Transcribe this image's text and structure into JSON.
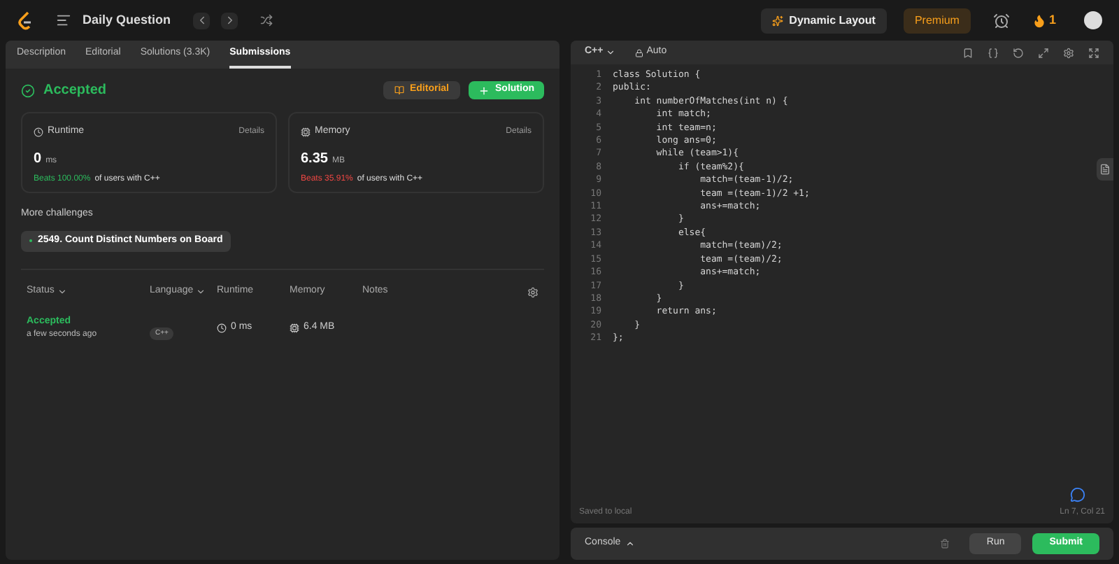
{
  "topbar": {
    "title": "Daily Question",
    "layout_button": "Dynamic Layout",
    "premium": "Premium",
    "streak": "1"
  },
  "tabs": [
    {
      "label": "Description",
      "selected": false
    },
    {
      "label": "Editorial",
      "selected": false
    },
    {
      "label": "Solutions (3.3K)",
      "selected": false
    },
    {
      "label": "Submissions",
      "selected": true
    }
  ],
  "result": {
    "status": "Accepted",
    "editorial_button": "Editorial",
    "solution_button": "Solution",
    "stats": [
      {
        "kind": "runtime",
        "label": "Runtime",
        "details": "Details",
        "value": "0",
        "unit": "ms",
        "beats": "Beats 100.00%",
        "beats_good": true,
        "suffix": "of users with C++"
      },
      {
        "kind": "memory",
        "label": "Memory",
        "details": "Details",
        "value": "6.35",
        "unit": "MB",
        "beats": "Beats 35.91%",
        "beats_good": false,
        "suffix": "of users with C++"
      }
    ]
  },
  "more_challenges": {
    "heading": "More challenges",
    "items": [
      "2549. Count Distinct Numbers on Board"
    ]
  },
  "table": {
    "columns": [
      {
        "label": "Status",
        "sortable": true
      },
      {
        "label": "Language",
        "sortable": true
      },
      {
        "label": "Runtime",
        "sortable": false
      },
      {
        "label": "Memory",
        "sortable": false
      },
      {
        "label": "Notes",
        "sortable": false
      }
    ],
    "rows": [
      {
        "status": "Accepted",
        "time": "a few seconds ago",
        "language": "C++",
        "runtime": "0 ms",
        "memory": "6.4 MB"
      }
    ]
  },
  "editor": {
    "language": "C++",
    "mode": "Auto",
    "lines": [
      {
        "number": "1",
        "code": "class Solution {"
      },
      {
        "number": "2",
        "code": "public:"
      },
      {
        "number": "3",
        "code": "    int numberOfMatches(int n) {"
      },
      {
        "number": "4",
        "code": "        int match;"
      },
      {
        "number": "5",
        "code": "        int team=n;"
      },
      {
        "number": "6",
        "code": "        long ans=0;"
      },
      {
        "number": "7",
        "code": "        while (team>1){"
      },
      {
        "number": "8",
        "code": "            if (team%2){"
      },
      {
        "number": "9",
        "code": "                match=(team-1)/2;"
      },
      {
        "number": "10",
        "code": "                team =(team-1)/2 +1;"
      },
      {
        "number": "11",
        "code": "                ans+=match;"
      },
      {
        "number": "12",
        "code": "            }"
      },
      {
        "number": "13",
        "code": "            else{"
      },
      {
        "number": "14",
        "code": "                match=(team)/2;"
      },
      {
        "number": "15",
        "code": "                team =(team)/2;"
      },
      {
        "number": "16",
        "code": "                ans+=match;"
      },
      {
        "number": "17",
        "code": "            }"
      },
      {
        "number": "18",
        "code": "        }"
      },
      {
        "number": "19",
        "code": "        return ans;"
      },
      {
        "number": "20",
        "code": "    }"
      },
      {
        "number": "21",
        "code": "};"
      }
    ],
    "saved": "Saved to local",
    "cursor": "Ln 7, Col 21"
  },
  "console": {
    "label": "Console",
    "run": "Run",
    "submit": "Submit"
  }
}
